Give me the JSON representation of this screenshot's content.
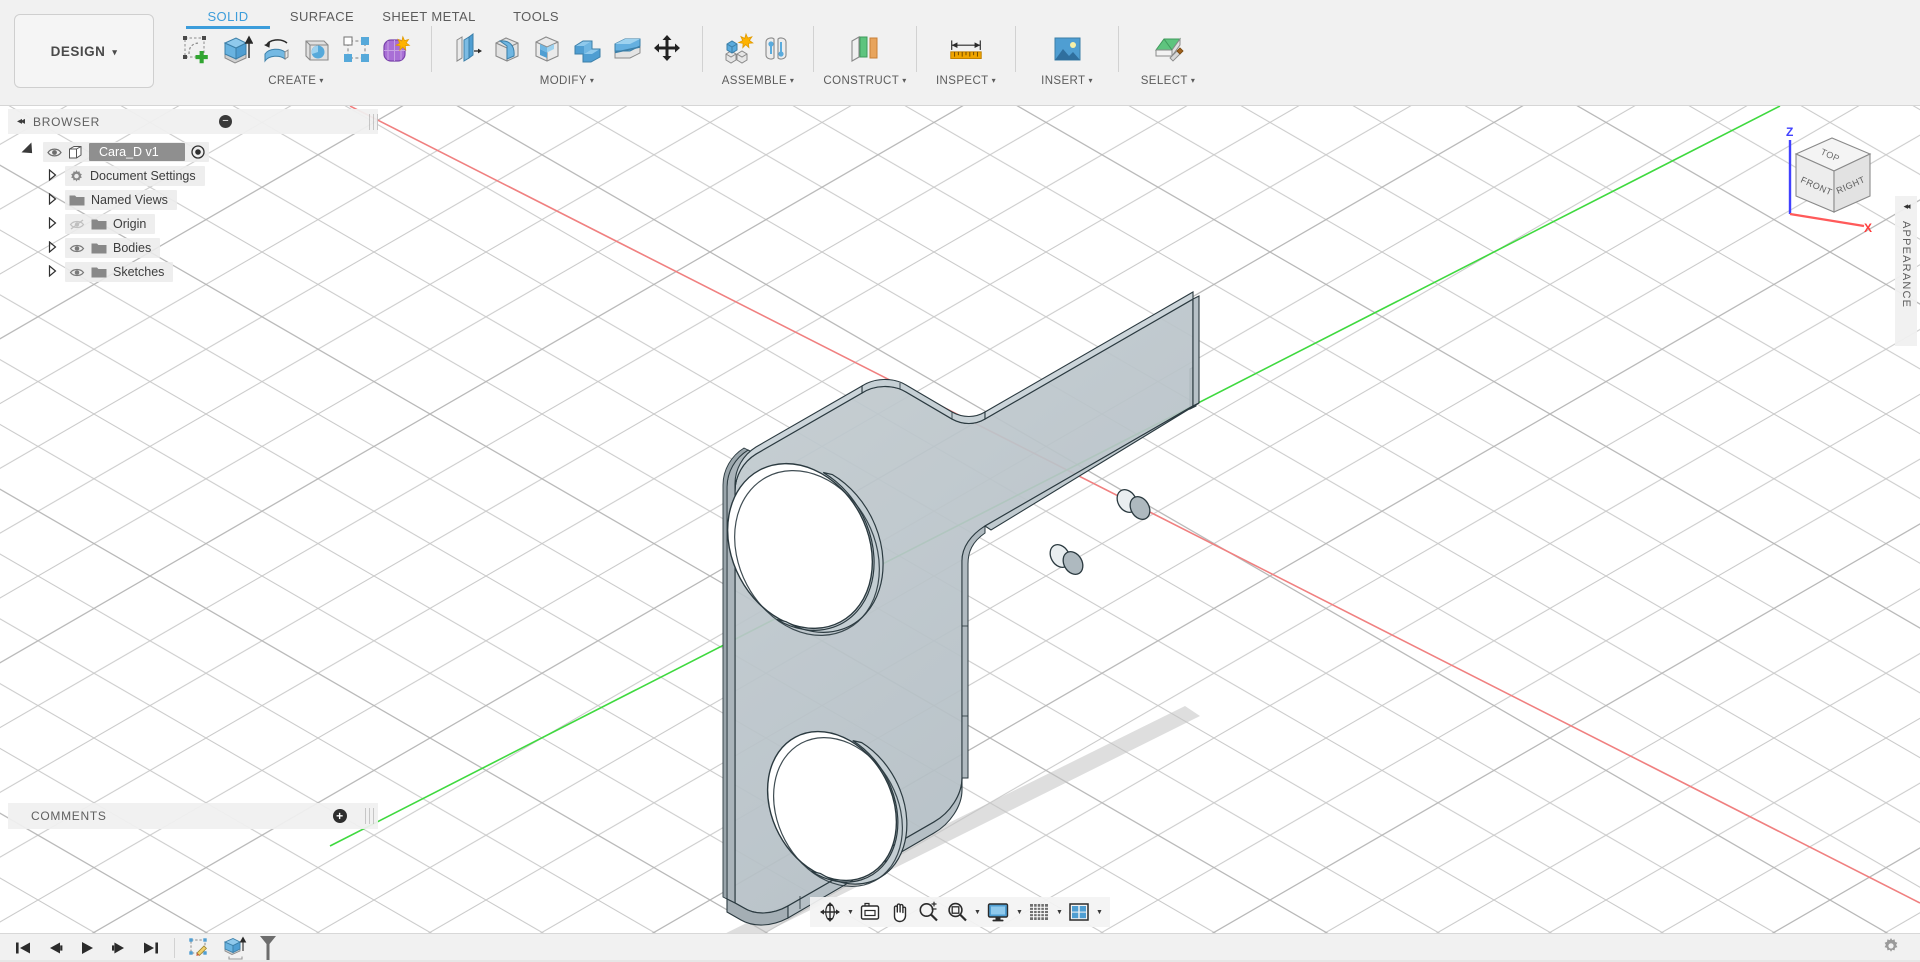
{
  "app": {
    "workspace_label": "DESIGN",
    "workspace_caret": "▾"
  },
  "ribbon": {
    "tabs": [
      {
        "label": "SOLID",
        "active": true
      },
      {
        "label": "SURFACE",
        "active": false
      },
      {
        "label": "SHEET METAL",
        "active": false
      },
      {
        "label": "TOOLS",
        "active": false
      }
    ],
    "groups": [
      {
        "label": "CREATE",
        "caret": "▾",
        "icons": [
          "create-sketch-icon",
          "extrude-icon",
          "revolve-icon",
          "sweep-icon",
          "pattern-icon",
          "form-icon"
        ]
      },
      {
        "label": "MODIFY",
        "caret": "▾",
        "icons": [
          "press-pull-icon",
          "fillet-icon",
          "shell-icon",
          "combine-icon",
          "split-face-icon",
          "move-copy-icon"
        ]
      },
      {
        "label": "ASSEMBLE",
        "caret": "▾",
        "icons": [
          "new-component-icon",
          "joint-icon"
        ]
      },
      {
        "label": "CONSTRUCT",
        "caret": "▾",
        "icons": [
          "offset-plane-icon"
        ]
      },
      {
        "label": "INSPECT",
        "caret": "▾",
        "icons": [
          "measure-icon"
        ]
      },
      {
        "label": "INSERT",
        "caret": "▾",
        "icons": [
          "insert-image-icon"
        ]
      },
      {
        "label": "SELECT",
        "caret": "▾",
        "icons": [
          "select-icon"
        ]
      }
    ]
  },
  "browser": {
    "title": "BROWSER",
    "collapse_icon": "◂◂",
    "minus_icon": "−",
    "root": {
      "label": "Cara_D v1",
      "icon": "component-cube-icon",
      "visibility_icon": "eye-icon",
      "activate_icon": "radio-dot-icon"
    },
    "items": [
      {
        "label": "Document Settings",
        "icon": "gear-icon",
        "has_eye": false,
        "eye_dim": false
      },
      {
        "label": "Named Views",
        "icon": "folder-icon",
        "has_eye": false,
        "eye_dim": false
      },
      {
        "label": "Origin",
        "icon": "folder-icon",
        "has_eye": true,
        "eye_dim": true
      },
      {
        "label": "Bodies",
        "icon": "folder-icon",
        "has_eye": true,
        "eye_dim": false
      },
      {
        "label": "Sketches",
        "icon": "folder-icon",
        "has_eye": true,
        "eye_dim": false
      }
    ]
  },
  "comments": {
    "title": "COMMENTS",
    "add_icon": "plus-circle-icon"
  },
  "appearance_panel": {
    "title": "APPEARANCE",
    "collapse_icon": "◂◂"
  },
  "viewcube": {
    "faces": {
      "top": "TOP",
      "front": "FRONT",
      "right": "RIGHT"
    },
    "axes": {
      "z": "Z",
      "x": "X"
    },
    "z_color": "#4040ff",
    "x_color": "#ff4040"
  },
  "navbar": {
    "items": [
      {
        "name": "orbit-icon",
        "caret": true
      },
      {
        "name": "look-at-icon",
        "caret": false
      },
      {
        "name": "pan-hand-icon",
        "caret": false
      },
      {
        "name": "zoom-icon",
        "caret": false
      },
      {
        "name": "fit-icon",
        "caret": true
      },
      {
        "name": "display-settings-icon",
        "caret": true
      },
      {
        "name": "grid-snaps-icon",
        "caret": true
      },
      {
        "name": "viewports-icon",
        "caret": true
      }
    ]
  },
  "timeline": {
    "buttons": [
      {
        "name": "go-to-beginning-button",
        "glyph": "skip-back-icon"
      },
      {
        "name": "step-back-button",
        "glyph": "step-back-icon"
      },
      {
        "name": "play-button",
        "glyph": "play-icon"
      },
      {
        "name": "step-forward-button",
        "glyph": "step-forward-icon"
      },
      {
        "name": "go-to-end-button",
        "glyph": "skip-forward-icon"
      }
    ],
    "features": [
      {
        "name": "timeline-sketch-feature",
        "glyph": "sketch-feature-icon"
      },
      {
        "name": "timeline-extrude-feature",
        "glyph": "extrude-feature-icon"
      }
    ],
    "settings_icon": "gear-icon"
  },
  "viewport": {
    "background": "#ffffff",
    "grid_color": "#c9c9c9",
    "axis_x_color": "#f08080",
    "axis_y_color": "#44d944",
    "model": {
      "name": "Cara_D bracket body",
      "face_color": "#b9c4c9",
      "edge_color": "#2b3a40",
      "shadow_color": "#c8c8c8",
      "holes": 2,
      "small_holes": 2
    }
  }
}
